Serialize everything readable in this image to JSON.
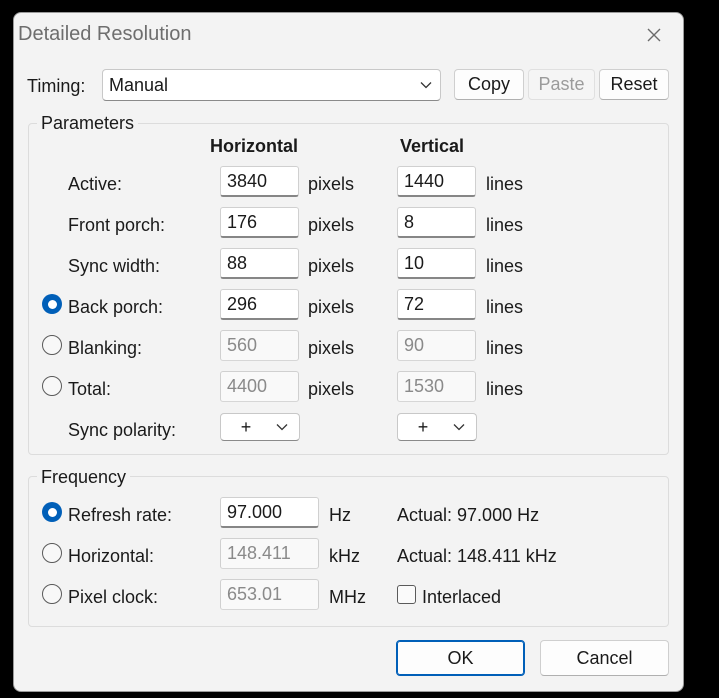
{
  "window": {
    "title": "Detailed Resolution"
  },
  "timing": {
    "label": "Timing:",
    "value": "Manual",
    "copy": "Copy",
    "paste": "Paste",
    "reset": "Reset"
  },
  "parameters": {
    "title": "Parameters",
    "horizontal_header": "Horizontal",
    "vertical_header": "Vertical",
    "rows": [
      {
        "label": "Active:",
        "h": "3840",
        "h_unit": "pixels",
        "v": "1440",
        "v_unit": "lines"
      },
      {
        "label": "Front porch:",
        "h": "176",
        "h_unit": "pixels",
        "v": "8",
        "v_unit": "lines"
      },
      {
        "label": "Sync width:",
        "h": "88",
        "h_unit": "pixels",
        "v": "10",
        "v_unit": "lines"
      },
      {
        "label": "Back porch:",
        "h": "296",
        "h_unit": "pixels",
        "v": "72",
        "v_unit": "lines"
      },
      {
        "label": "Blanking:",
        "h": "560",
        "h_unit": "pixels",
        "v": "90",
        "v_unit": "lines"
      },
      {
        "label": "Total:",
        "h": "4400",
        "h_unit": "pixels",
        "v": "1530",
        "v_unit": "lines"
      }
    ],
    "sync_polarity": {
      "label": "Sync polarity:",
      "h": "+",
      "v": "+"
    }
  },
  "frequency": {
    "title": "Frequency",
    "refresh": {
      "label": "Refresh rate:",
      "value": "97.000",
      "unit": "Hz",
      "actual": "Actual: 97.000 Hz"
    },
    "horizontal": {
      "label": "Horizontal:",
      "value": "148.411",
      "unit": "kHz",
      "actual": "Actual: 148.411 kHz"
    },
    "pixel_clock": {
      "label": "Pixel clock:",
      "value": "653.01",
      "unit": "MHz"
    },
    "interlaced": "Interlaced"
  },
  "buttons": {
    "ok": "OK",
    "cancel": "Cancel"
  },
  "colors": {
    "accent": "#005fb8",
    "window_bg": "#f3f3f3",
    "backdrop": "#000000"
  }
}
